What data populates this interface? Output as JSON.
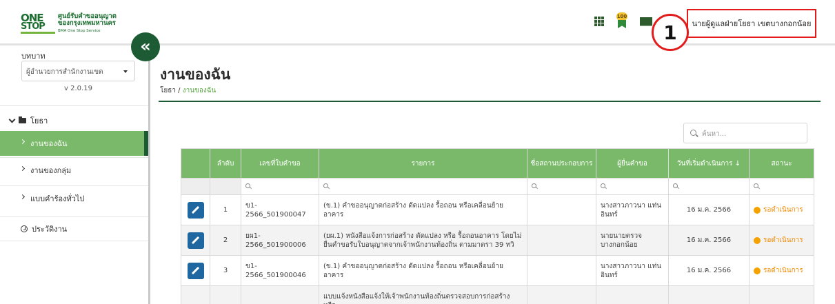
{
  "header": {
    "logo": {
      "line1": "ศูนย์รับคำขออนุญาต",
      "line2": "ของกรุงเทพมหานคร",
      "line3": "BMA One Stop Service",
      "mark_top": "ONE",
      "mark_bottom": "STOP"
    },
    "award_badge": "100",
    "step_number": "1",
    "user_name": "นายผู้ดูแลฝ่ายโยธา เขตบางกอกน้อย",
    "colors": {
      "brand": "#1d5b34",
      "accent": "#7ab96a",
      "highlight": "#e21b1b"
    }
  },
  "sidebar": {
    "role_label": "บทบาท",
    "role_value": "ผู้อำนวยการสำนักงานเขต",
    "version": "v 2.0.19",
    "collapse_icon": "«",
    "tree_root": "โยธา",
    "items": [
      {
        "label": "งานของฉัน",
        "active": true
      },
      {
        "label": "งานของกลุ่ม",
        "active": false
      },
      {
        "label": "แบบคำร้องทั่วไป",
        "active": false
      }
    ],
    "history": "ประวัติงาน"
  },
  "main": {
    "title": "งานของฉัน",
    "breadcrumb_root": "โยธา",
    "breadcrumb_sep": " / ",
    "breadcrumb_current": "งานของฉัน",
    "search_placeholder": "ค้นหา..."
  },
  "table": {
    "columns": [
      "",
      "ลำดับ",
      "เลขที่ใบคำขอ",
      "รายการ",
      "ชื่อสถานประกอบการ",
      "ผู้ยื่นคำขอ",
      "วันที่เริ่มดำเนินการ",
      "สถานะ"
    ],
    "sort_indicator": "↓",
    "rows": [
      {
        "no": "1",
        "request_no": "ข1-2566_501900047",
        "item": "(ข.1) คำขออนุญาตก่อสร้าง ดัดแปลง รื้อถอน หรือเคลื่อนย้ายอาคาร",
        "business": "",
        "applicant": "นางสาวภาวนา แท่นอินทร์",
        "start_date": "16 ม.ค. 2566",
        "status": "รอดำเนินการ"
      },
      {
        "no": "2",
        "request_no": "ยผ1-2566_501900006",
        "item": "(ยผ.1) หนังสือแจ้งการก่อสร้าง ดัดแปลง หรือ รื้อถอนอาคาร โดยไม่ยื่นคำขอรับใบอนุญาตจากเจ้าพนักงานท้องถิ่น ตามมาตรา 39 ทวิ",
        "business": "",
        "applicant": "นายนายตรวจ บางกอกน้อย",
        "start_date": "16 ม.ค. 2566",
        "status": "รอดำเนินการ"
      },
      {
        "no": "3",
        "request_no": "ข1-2566_501900046",
        "item": "(ข.1) คำขออนุญาตก่อสร้าง ดัดแปลง รื้อถอน หรือเคลื่อนย้ายอาคาร",
        "business": "",
        "applicant": "นางสาวภาวนา แท่นอินทร์",
        "start_date": "16 ม.ค. 2566",
        "status": "รอดำเนินการ"
      },
      {
        "no": "",
        "request_no": "",
        "item": "แบบแจ้งหนังสือแจ้งให้เจ้าพนักงานท้องถิ่นตรวจสอบการก่อสร้าง หรือ",
        "business": "",
        "applicant": "",
        "start_date": "",
        "status": ""
      }
    ]
  }
}
